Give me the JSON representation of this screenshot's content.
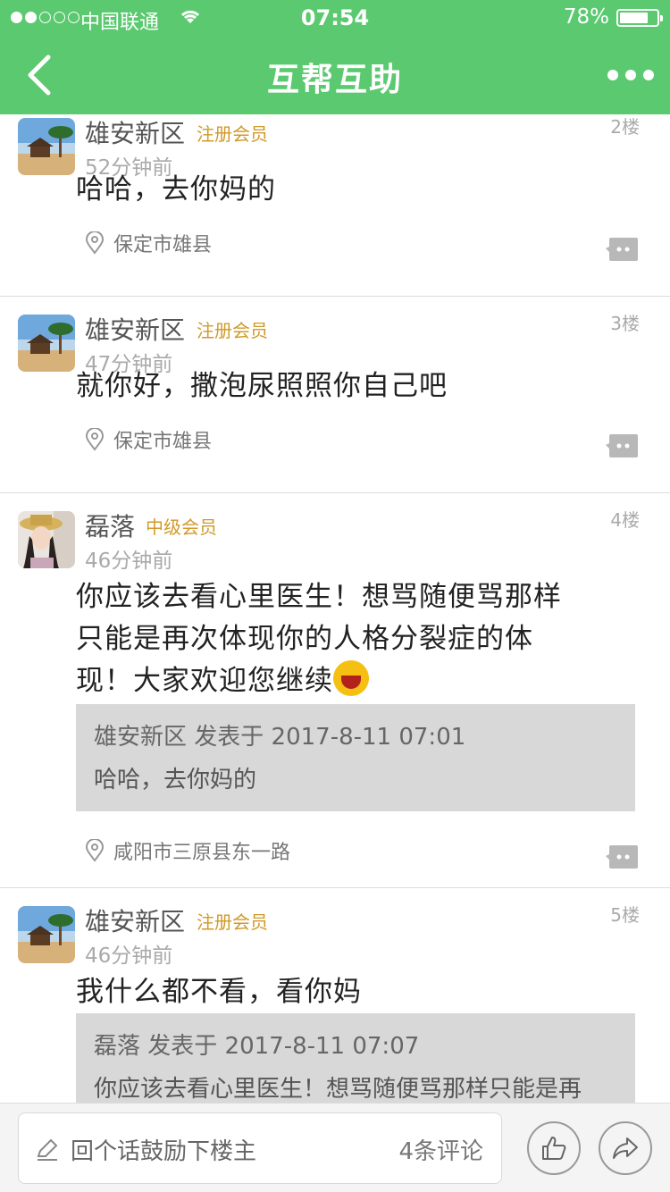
{
  "status_bar": {
    "carrier": "中国联通",
    "time": "07:54",
    "battery_pct": "78%",
    "battery_level": 0.78
  },
  "nav": {
    "title": "互帮互助"
  },
  "posts": [
    {
      "username": "雄安新区",
      "badge": "注册会员",
      "floor": "2楼",
      "time_ago": "52分钟前",
      "content": "哈哈，去你妈的",
      "location": "保定市雄县"
    },
    {
      "username": "雄安新区",
      "badge": "注册会员",
      "floor": "3楼",
      "time_ago": "47分钟前",
      "content": "就你好，撒泡尿照照你自己吧",
      "location": "保定市雄县"
    },
    {
      "username": "磊落",
      "badge": "中级会员",
      "floor": "4楼",
      "time_ago": "46分钟前",
      "content_lines": [
        "你应该去看心里医生！想骂随便骂那样",
        "只能是再次体现你的人格分裂症的体",
        "现！大家欢迎您继续"
      ],
      "quote": {
        "header": "雄安新区 发表于 2017-8-11 07:01",
        "body": "哈哈，去你妈的"
      },
      "location": "咸阳市三原县东一路"
    },
    {
      "username": "雄安新区",
      "badge": "注册会员",
      "floor": "5楼",
      "time_ago": "46分钟前",
      "content": "我什么都不看，看你妈",
      "quote": {
        "header": "磊落 发表于 2017-8-11 07:07",
        "body": "你应该去看心里医生！想骂随便骂那样只能是再"
      }
    }
  ],
  "bottom_bar": {
    "reply_placeholder": "回个话鼓励下楼主",
    "comment_count": "4条评论"
  }
}
